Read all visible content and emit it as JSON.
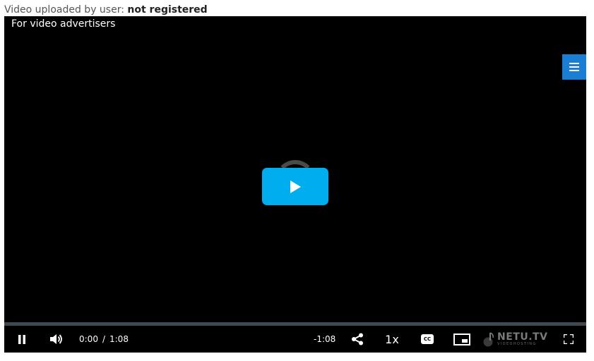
{
  "header": {
    "uploader_prefix": "Video uploaded by user: ",
    "uploader_status": "not registered"
  },
  "player": {
    "ad_label": "For video advertisers",
    "menu_icon": "hamburger-menu-icon",
    "play_icon": "play-icon",
    "progress": 0.0,
    "colors": {
      "accent": "#00adef",
      "menu": "#1a7fd4",
      "background": "#000000",
      "track": "#3f4952"
    }
  },
  "controls": {
    "pause_icon": "pause-icon",
    "volume_icon": "volume-icon",
    "current_time": "0:00",
    "time_separator": "/",
    "duration": "1:08",
    "remaining_time": "-1:08",
    "share_icon": "share-icon",
    "speed_label": "1x",
    "captions_label": "CC",
    "pip_icon": "picture-in-picture-icon",
    "brand_name": "NETU.TV",
    "brand_tagline": "VIDEOHOSTING",
    "fullscreen_icon": "fullscreen-icon"
  }
}
